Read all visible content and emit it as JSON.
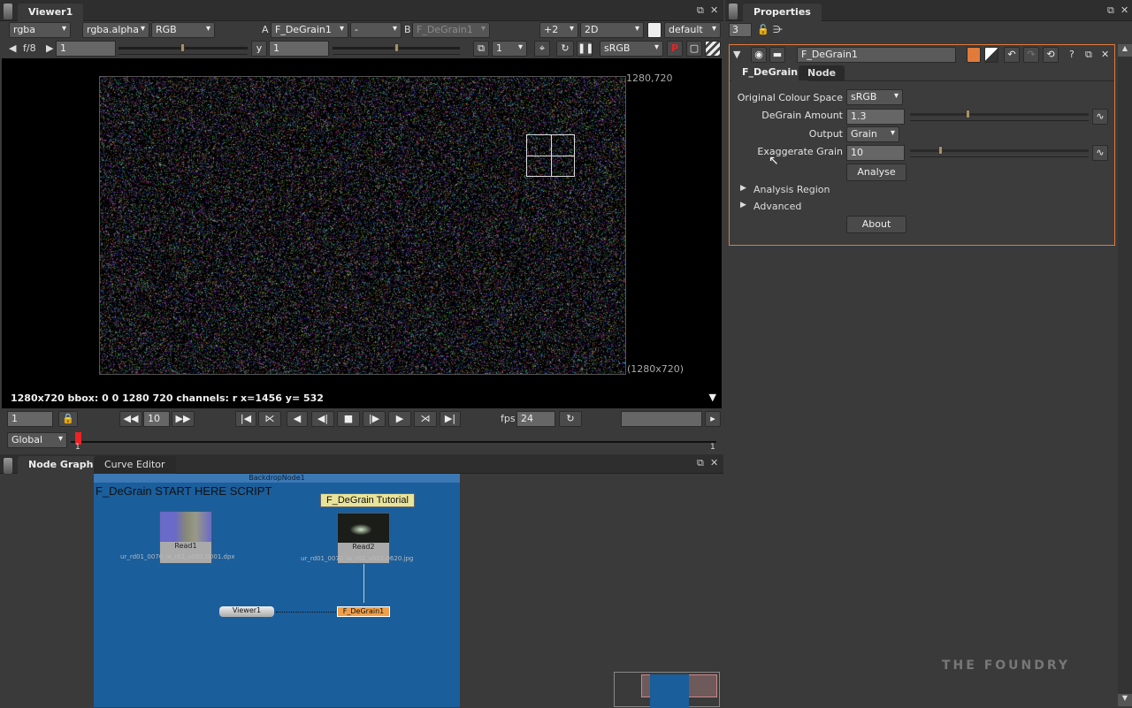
{
  "viewer": {
    "tab": "Viewer1",
    "channels": "rgba",
    "alpha": "rgba.alpha",
    "display": "RGB",
    "a_label": "A",
    "a_input": "F_DeGrain1",
    "op": "-",
    "b_label": "B",
    "b_input": "F_DeGrain1",
    "zoom": "+2",
    "view": "2D",
    "lut_default": "default",
    "fstop": "f/8",
    "gain": "1",
    "gamma_label": "y",
    "gamma": "1",
    "proxy": "1",
    "colorspace": "sRGB",
    "corner_tr": "1280,720",
    "corner_br": "(1280x720)",
    "info": "1280x720 bbox: 0 0 1280 720 channels: r  x=1456 y= 532",
    "frame": "1",
    "step": "10",
    "fps_label": "fps",
    "fps": "24",
    "range": "Global",
    "tl_start": "1",
    "tl_end": "1"
  },
  "nodegraph": {
    "tabs": [
      "Node Graph",
      "Curve Editor"
    ],
    "backdrop_name": "BackdropNode1",
    "backdrop_title": "F_DeGrain START HERE SCRIPT",
    "sticky": "F_DeGrain Tutorial",
    "read1": {
      "name": "Read1",
      "file": "ur_rd01_0070_la_r01_v002.0001.dpx"
    },
    "read2": {
      "name": "Read2",
      "file": "ur_rd01_0070_la_r02_v001.0620.jpg"
    },
    "viewer_node": "Viewer1",
    "degrain_node": "F_DeGrain1",
    "backdrop_color": "#1a5e9c"
  },
  "properties": {
    "tab": "Properties",
    "max_panels": "3",
    "node_name": "F_DeGrain1",
    "tabs": [
      "F_DeGrain",
      "Node"
    ],
    "fields": {
      "colour_space_label": "Original Colour Space",
      "colour_space": "sRGB",
      "amount_label": "DeGrain Amount",
      "amount": "1.3",
      "output_label": "Output",
      "output": "Grain",
      "exaggerate_label": "Exaggerate Grain",
      "exaggerate": "10"
    },
    "analyse": "Analyse",
    "sections": [
      "Analysis Region",
      "Advanced"
    ],
    "about": "About",
    "accent": "#e07b3c"
  },
  "logo": "THE FOUNDRY"
}
